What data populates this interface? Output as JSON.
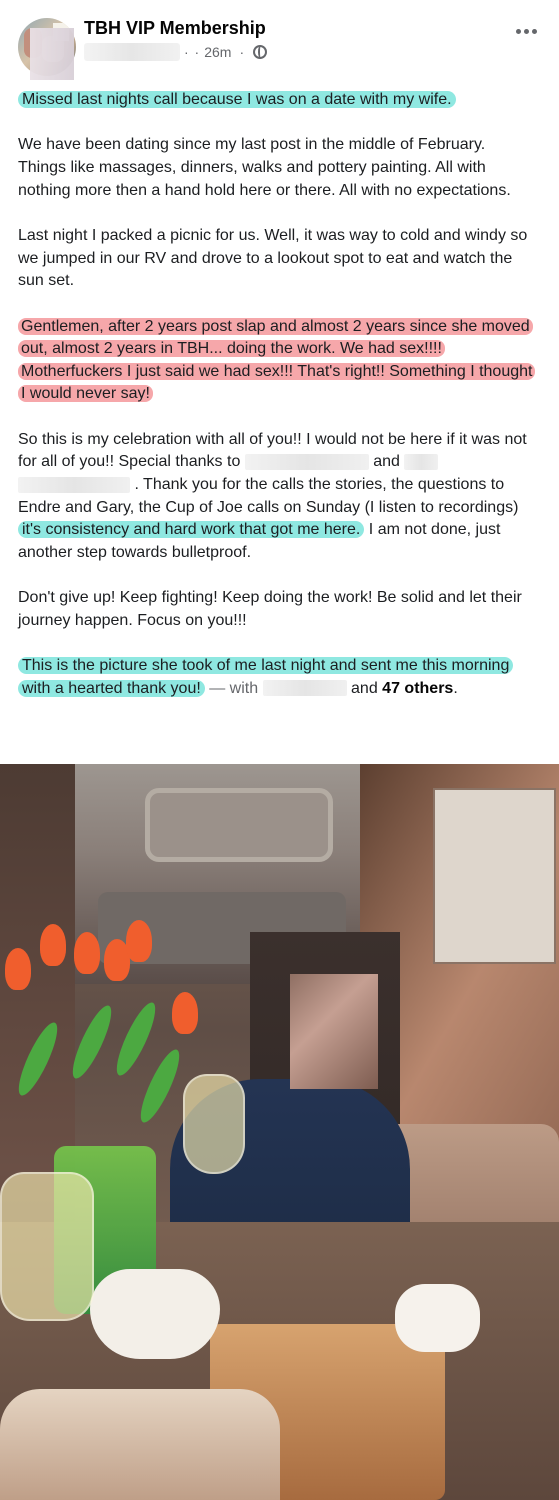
{
  "post": {
    "group_name": "TBH VIP Membership",
    "time": "26m",
    "meta_separator": "· ·",
    "meta_dot": "·"
  },
  "icons": {
    "more": "more-horizontal-icon",
    "privacy": "globe-icon"
  },
  "content": {
    "p1": "Missed last nights call because I was on a date with my wife.",
    "p2": "We have been dating since my last post in the middle of February. Things like massages, dinners, walks and pottery painting. All with nothing more then a hand hold here or there. All with no expectations.",
    "p3": "Last night I packed a picnic for us. Well, it was way to cold and windy so we jumped in our RV and drove to a lookout spot to eat and watch the sun set.",
    "p4": "Gentlemen, after 2 years post slap and almost 2 years since she moved out, almost 2 years in TBH... doing the work. We had sex!!!! Motherfuckers I just said we had sex!!! That's right!! Something I thought I would never say!",
    "p5_part1": "So this is my celebration with all of you!! I would not be here if it was not for all of you!! Special thanks to ",
    "p5_and": " and ",
    "p5_part2": ". Thank you for the calls the stories, the questions to Endre and Gary, the Cup of Joe calls on Sunday (I listen to recordings) ",
    "p5_highlight": "it's consistency and hard work that got me here.",
    "p5_part3": " I am not done, just another step towards bulletproof.",
    "p6": "Don't give up! Keep fighting! Keep doing the work! Be solid and let their journey happen. Focus on you!!!",
    "p7_highlight": "This is the picture she took of me last night and sent me this morning with a hearted thank you!",
    "p7_with": " — with ",
    "p7_and": " and ",
    "p7_count": "47",
    "p7_others": "others",
    "p7_end": "."
  },
  "colors": {
    "teal_highlight": "#8fe8e1",
    "red_highlight": "#f6a7aa",
    "text": "#1c1e21",
    "muted": "#65676b"
  }
}
